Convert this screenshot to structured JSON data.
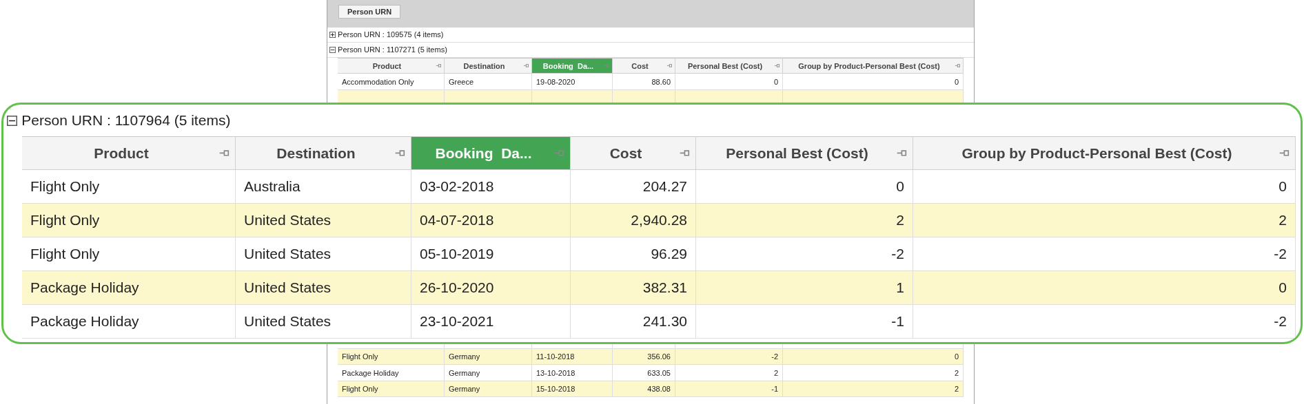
{
  "group_panel": {
    "chips": [
      "Person URN"
    ]
  },
  "grid": {
    "groups": [
      {
        "label": "Person URN : 109575 (4 items)",
        "expanded": false
      },
      {
        "label": "Person URN : 1107271 (5 items)",
        "expanded": true
      }
    ],
    "columns": [
      {
        "label": "Product",
        "kind": "text",
        "selected": false
      },
      {
        "label": "Destination",
        "kind": "text",
        "selected": false
      },
      {
        "label": "Booking  Da...",
        "kind": "text",
        "selected": true
      },
      {
        "label": "Cost",
        "kind": "number",
        "selected": false
      },
      {
        "label": "Personal Best (Cost)",
        "kind": "number",
        "selected": false
      },
      {
        "label": "Group by Product-Personal Best (Cost)",
        "kind": "number",
        "selected": false
      }
    ],
    "top_rows": [
      [
        "Accommodation Only",
        "Greece",
        "19-08-2020",
        "88.60",
        "0",
        "0"
      ]
    ],
    "bottom_rows": [
      [
        "Flight Only",
        "Germany",
        "11-10-2018",
        "356.06",
        "-2",
        "0"
      ],
      [
        "Package Holiday",
        "Germany",
        "13-10-2018",
        "633.05",
        "2",
        "2"
      ],
      [
        "Flight Only",
        "Germany",
        "15-10-2018",
        "438.08",
        "-1",
        "2"
      ]
    ]
  },
  "callout": {
    "group": {
      "label": "Person URN : 1107964 (5 items)",
      "expanded": true
    },
    "columns": [
      {
        "label": "Product",
        "kind": "text",
        "selected": false
      },
      {
        "label": "Destination",
        "kind": "text",
        "selected": false
      },
      {
        "label": "Booking  Da...",
        "kind": "text",
        "selected": true
      },
      {
        "label": "Cost",
        "kind": "number",
        "selected": false
      },
      {
        "label": "Personal Best (Cost)",
        "kind": "number",
        "selected": false
      },
      {
        "label": "Group by Product-Personal Best (Cost)",
        "kind": "number",
        "selected": false
      }
    ],
    "rows": [
      [
        "Flight Only",
        "Australia",
        "03-02-2018",
        "204.27",
        "0",
        "0"
      ],
      [
        "Flight Only",
        "United States",
        "04-07-2018",
        "2,940.28",
        "2",
        "2"
      ],
      [
        "Flight Only",
        "United States",
        "05-10-2019",
        "96.29",
        "-2",
        "-2"
      ],
      [
        "Package Holiday",
        "United States",
        "26-10-2020",
        "382.31",
        "1",
        "0"
      ],
      [
        "Package Holiday",
        "United States",
        "23-10-2021",
        "241.30",
        "-1",
        "-2"
      ]
    ]
  }
}
